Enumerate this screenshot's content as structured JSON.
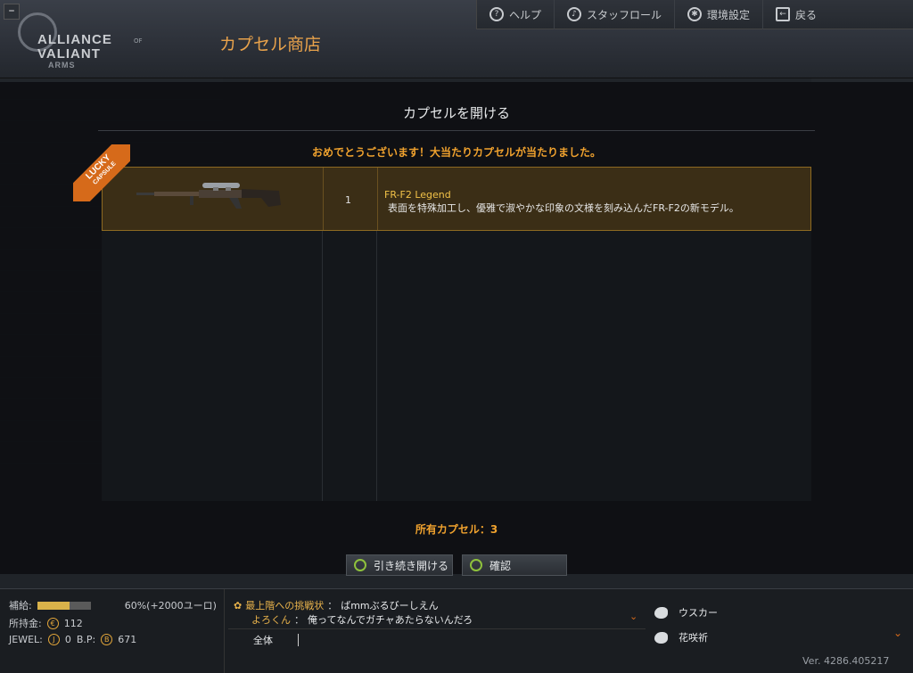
{
  "app": {
    "logo_line1": "ALLIANCE",
    "logo_of": "OF",
    "logo_line2": "VALIANT",
    "logo_line3": "ARMS",
    "shop_title": "カプセル商店"
  },
  "topnav": {
    "help": "ヘルプ",
    "staff_roll": "スタッフロール",
    "settings": "環境設定",
    "back": "戻る"
  },
  "modal": {
    "title": "カプセルを開ける",
    "congrats": "おめでとうございます！大当たりカプセルが当たりました。",
    "lucky_badge": "LUCKY",
    "lucky_sub": "CAPSULE",
    "item": {
      "quantity": "1",
      "name": "FR-F2 Legend",
      "description": "表面を特殊加工し、優雅で淑やかな印象の文様を刻み込んだFR-F2の新モデル。"
    },
    "capsule_count": "所有カプセル：3",
    "continue_label": "引き続き開ける",
    "confirm_label": "確認"
  },
  "status": {
    "supply_label": "補給:",
    "supply_value": "60%(+2000ユーロ)",
    "supply_fraction": 0.6,
    "money_label": "所持金:",
    "money_value": "112",
    "jewel_label": "JEWEL:",
    "jewel_value": "0",
    "bp_label": "B.P:",
    "bp_value": "671"
  },
  "chat": {
    "messages": [
      {
        "name": "最上階への挑戦状",
        "sep": "：",
        "text": "ばmmぶるびーしえん"
      },
      {
        "name": "よろくん",
        "sep": "：",
        "text": "俺ってなんでガチャあたらないんだろ"
      }
    ],
    "channel": "全体"
  },
  "friends": [
    {
      "name": "ウスカー"
    },
    {
      "name": "花咲祈"
    }
  ],
  "version": "Ver. 4286.405217"
}
